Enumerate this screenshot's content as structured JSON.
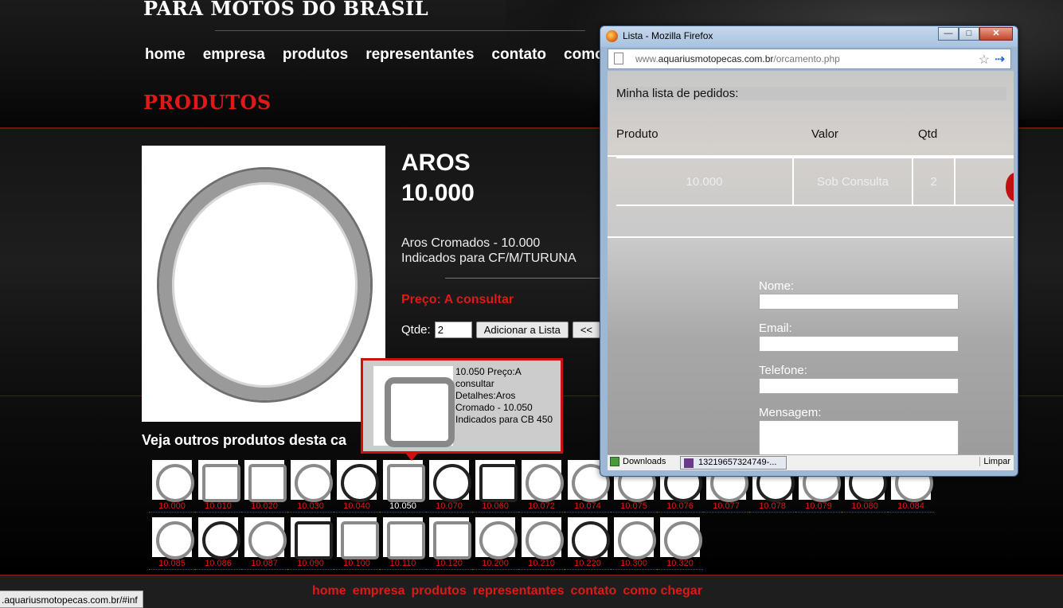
{
  "site": {
    "brand": "PARA MOTOS DO BRASIL",
    "nav": [
      "home",
      "empresa",
      "produtos",
      "representantes",
      "contato",
      "como c"
    ],
    "section_title": "PRODUTOS"
  },
  "product": {
    "name": "AROS",
    "code": "10.000",
    "desc_line1": "Aros Cromados - 10.000",
    "desc_line2": "Indicados para CF/M/TURUNA",
    "price": "Preço: A consultar",
    "qty_label": "Qtde:",
    "qty_value": "2",
    "add_button": "Adicionar a Lista",
    "back_button": "<<"
  },
  "tooltip": {
    "text": "10.050 Preço:A consultar Detalhes:Aros Cromado - 10.050 Indicados para CB 450"
  },
  "other_products": {
    "title": "Veja outros produtos desta ca",
    "row1": [
      "10.000",
      "10.010",
      "10.020",
      "10.030",
      "10.040",
      "10.050",
      "10.070",
      "10.060",
      "10.072",
      "10.074",
      "10.075",
      "10.076",
      "10.077",
      "10.078",
      "10.079",
      "10.080",
      "10.084"
    ],
    "row2": [
      "10.085",
      "10.086",
      "10.087",
      "10.090",
      "10.100",
      "10.110",
      "10.120",
      "10.200",
      "10.210",
      "10.220",
      "10.300",
      "10.320"
    ]
  },
  "footer": {
    "nav": [
      "home",
      "empresa",
      "produtos",
      "representantes",
      "contato",
      "como chegar"
    ],
    "status_url": ".aquariusmotopecas.com.br/#inf"
  },
  "popup": {
    "window_title": "Lista - Mozilla Firefox",
    "url_prefix": "www.",
    "url_domain": "aquariusmotopecas.com.br",
    "url_path": "/orcamento.php",
    "heading": "Minha lista de pedidos:",
    "col_produto": "Produto",
    "col_valor": "Valor",
    "col_qtd": "Qtd",
    "row": {
      "produto": "10.000",
      "valor": "Sob Consulta",
      "qtd": "2"
    },
    "nome_label": "Nome:",
    "email_label": "Email:",
    "telefone_label": "Telefone:",
    "mensagem_label": "Mensagem:",
    "downloads_label": "Downloads",
    "download_file": "13219657324749-...",
    "clear_label": "Limpar"
  }
}
